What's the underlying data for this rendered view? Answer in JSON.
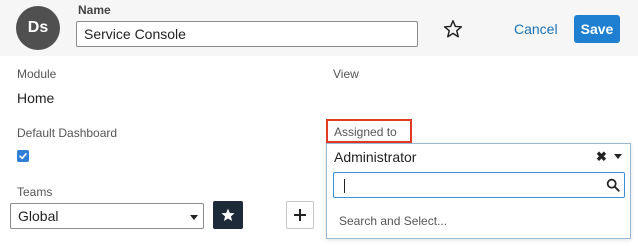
{
  "header": {
    "avatar_initials": "Ds",
    "name_label": "Name",
    "name_value": "Service Console",
    "cancel_label": "Cancel",
    "save_label": "Save",
    "star_icon": "star-outline-icon"
  },
  "fields": {
    "module_label": "Module",
    "module_value": "Home",
    "view_label": "View",
    "default_dashboard_label": "Default Dashboard",
    "default_dashboard_checked": true,
    "teams_label": "Teams",
    "teams_value": "Global"
  },
  "assigned_to": {
    "label": "Assigned to",
    "selected": "Administrator",
    "clear_symbol": "✖",
    "search_value": "",
    "search_hint": "Search and Select..."
  },
  "colors": {
    "accent": "#1f7fd0",
    "highlight": "#e23b23",
    "primary_dark": "#1d2a3a"
  }
}
